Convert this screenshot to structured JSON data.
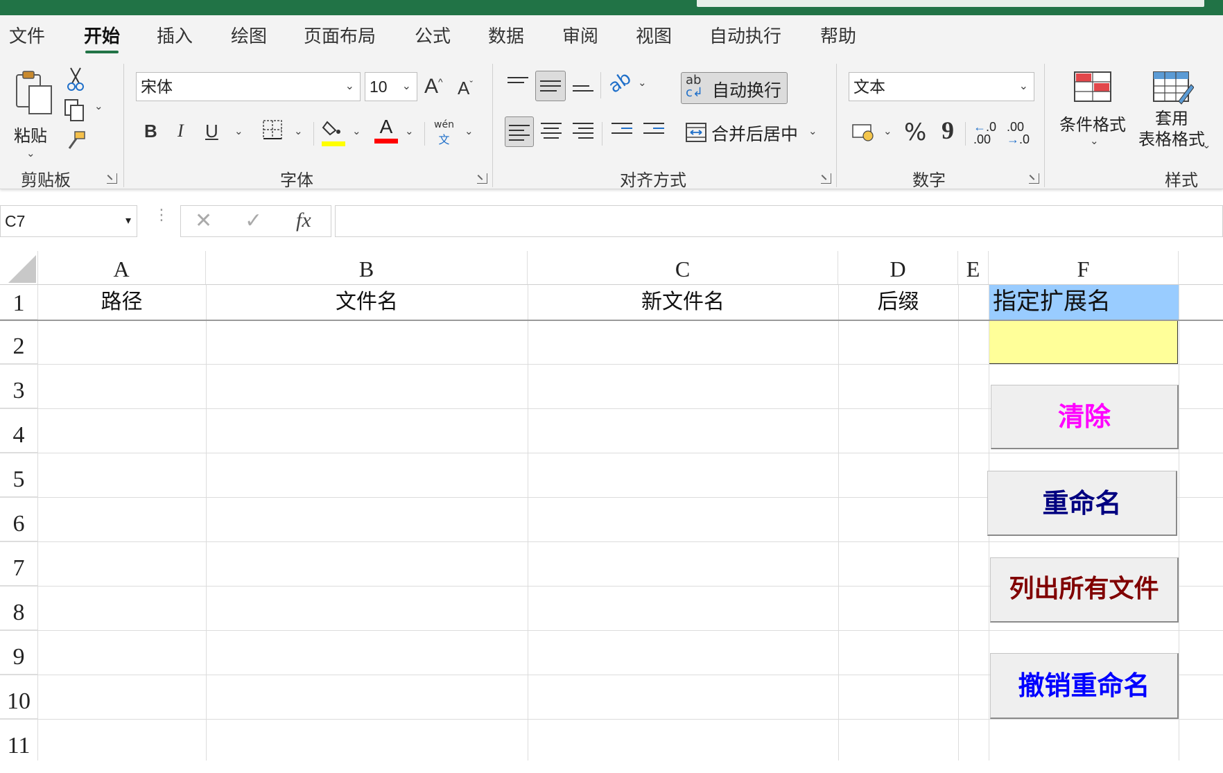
{
  "ribbon_tabs": [
    "文件",
    "开始",
    "插入",
    "绘图",
    "页面布局",
    "公式",
    "数据",
    "审阅",
    "视图",
    "自动执行",
    "帮助"
  ],
  "active_tab": "开始",
  "clipboard": {
    "paste_label": "粘贴",
    "group_label": "剪贴板"
  },
  "font": {
    "name": "宋体",
    "size": "10",
    "bold": "B",
    "italic": "I",
    "underline": "U",
    "grow": "A",
    "shrink": "A",
    "phonetic_top": "wén",
    "phonetic_bottom": "文",
    "color_letter": "A",
    "group_label": "字体",
    "highlight_color": "#ffff00",
    "font_color": "#ff0000"
  },
  "alignment": {
    "wrap_text": "自动换行",
    "merge_center": "合并后居中",
    "group_label": "对齐方式"
  },
  "number": {
    "format": "文本",
    "percent": "%",
    "comma": "9",
    "inc_decimal_top": ".0",
    "inc_decimal_bottom": ".00",
    "dec_decimal_top": ".00",
    "dec_decimal_bottom": ".0",
    "group_label": "数字"
  },
  "styles": {
    "conditional": "条件格式",
    "table_line1": "套用",
    "table_line2": "表格格式",
    "group_label": "样式"
  },
  "formula_bar": {
    "name_box": "C7",
    "fx": "fx",
    "content": ""
  },
  "columns": [
    "A",
    "B",
    "C",
    "D",
    "E",
    "F"
  ],
  "rows": [
    "1",
    "2",
    "3",
    "4",
    "5",
    "6",
    "7",
    "8",
    "9",
    "10",
    "11"
  ],
  "header_row": {
    "A": "路径",
    "B": "文件名",
    "C": "新文件名",
    "D": "后缀",
    "F": "指定扩展名"
  },
  "cell_F2": "",
  "buttons": [
    {
      "label": "清除",
      "color": "#ff00ff"
    },
    {
      "label": "重命名",
      "color": "#000080"
    },
    {
      "label": "列出所有文件",
      "color": "#800000"
    },
    {
      "label": "撤销重命名",
      "color": "#0000ff"
    }
  ],
  "colors": {
    "title_bar": "#217346",
    "f1_fill": "#99ccff",
    "f2_fill": "#ffff99"
  }
}
